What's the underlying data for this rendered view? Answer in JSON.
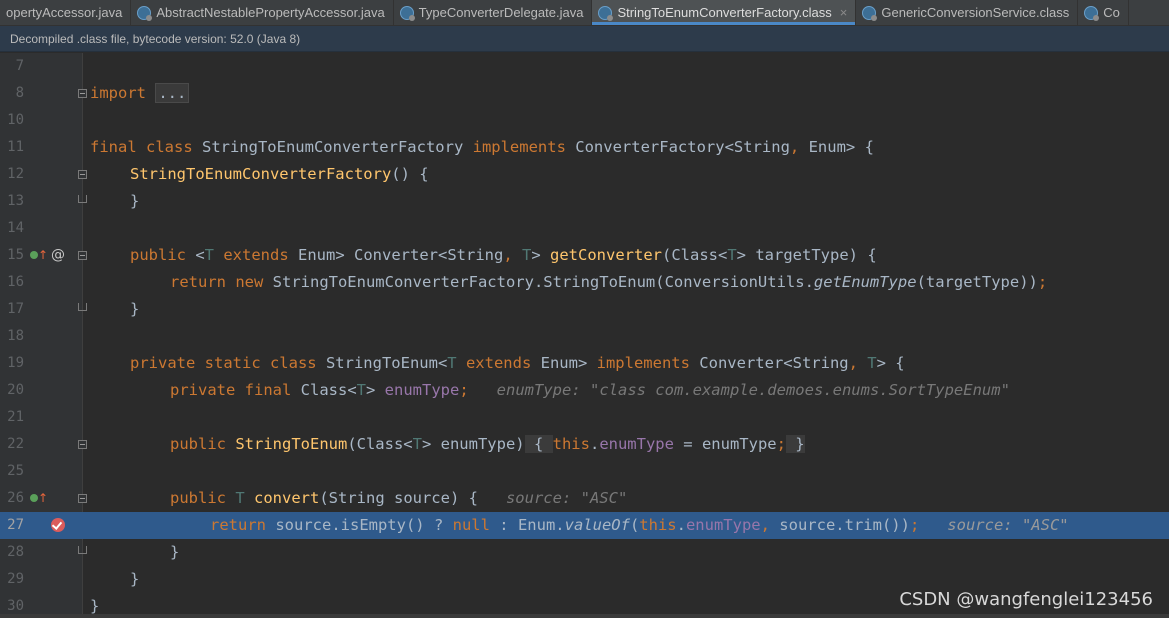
{
  "tabs": [
    {
      "label": "opertyAccessor.java",
      "icon": null
    },
    {
      "label": "AbstractNestablePropertyAccessor.java",
      "icon": "class-file-icon"
    },
    {
      "label": "TypeConverterDelegate.java",
      "icon": "class-file-icon"
    },
    {
      "label": "StringToEnumConverterFactory.class",
      "icon": "class-file-icon",
      "active": true
    },
    {
      "label": "GenericConversionService.class",
      "icon": "class-file-icon"
    },
    {
      "label": "Co",
      "icon": "class-file-icon"
    }
  ],
  "tab_close_glyph": "×",
  "notice": "Decompiled .class file, bytecode version: 52.0 (Java 8)",
  "line_numbers": [
    "7",
    "8",
    "10",
    "11",
    "12",
    "13",
    "14",
    "15",
    "16",
    "17",
    "18",
    "19",
    "20",
    "21",
    "22",
    "25",
    "26",
    "27",
    "28",
    "29",
    "30"
  ],
  "code": {
    "l8": {
      "kw": "import",
      "fold": "..."
    },
    "l11": {
      "kw1": "final class ",
      "name": "StringToEnumConverterFactory ",
      "kw2": "implements ",
      "rest": "ConverterFactory<String",
      "comma": ",",
      "rest2": " Enum> {"
    },
    "l12": {
      "fn": "StringToEnumConverterFactory",
      "rest": "() {"
    },
    "l13": {
      "text": "}"
    },
    "l15": {
      "kw": "public ",
      "lt": "<",
      "tp": "T",
      "kw2": " extends ",
      "mid": "Enum> Converter<String",
      "comma": ",",
      "tp2": " T",
      "gt": "> ",
      "fn": "getConverter",
      "rest": "(Class<",
      "tp3": "T",
      "rest2": "> targetType) {"
    },
    "l16": {
      "kw": "return new ",
      "a": "StringToEnumConverterFactory.StringToEnum(ConversionUtils.",
      "it": "getEnumType",
      "b": "(targetType))",
      "semi": ";"
    },
    "l17": {
      "text": "}"
    },
    "l19": {
      "kw": "private static class ",
      "name": "StringToEnum<",
      "tp": "T",
      "kw2": " extends ",
      "mid": "Enum> ",
      "kw3": "implements ",
      "rest": "Converter<String",
      "comma": ",",
      "tp2": " T",
      "rest2": "> {"
    },
    "l20": {
      "kw": "private final ",
      "a": "Class<",
      "tp": "T",
      "b": "> ",
      "fld": "enumType",
      "semi": ";",
      "hint": "enumType: \"class com.example.demoes.enums.SortTypeEnum\""
    },
    "l22": {
      "kw": "public ",
      "fn": "StringToEnum",
      "a": "(Class<",
      "tp": "T",
      "b": "> enumType)",
      "c": " { ",
      "kw2": "this",
      "d": ".",
      "fld": "enumType",
      "e": " = enumType",
      "semi": ";",
      "f": " }"
    },
    "l26": {
      "kw": "public ",
      "tp": "T ",
      "fn": "convert",
      "rest": "(String source) {",
      "hint": "source: \"ASC\""
    },
    "l27": {
      "kw": "return ",
      "a": "source.isEmpty() ? ",
      "kw2": "null",
      "b": " : Enum.",
      "it": "valueOf",
      "c": "(",
      "kw3": "this",
      "d": ".",
      "fld": "enumType",
      "comma": ",",
      "e": " source.trim())",
      "semi": ";",
      "hint": "source: \"ASC\""
    },
    "l28": {
      "text": "}"
    },
    "l29": {
      "text": "}"
    },
    "l30": {
      "text": "}"
    }
  },
  "watermark": "CSDN @wangfenglei123456",
  "colors": {
    "keyword": "#cc7832",
    "function": "#ffc66d",
    "type_param": "#507874",
    "field": "#9876aa",
    "current_line": "#2f5a8c",
    "active_tab_underline": "#4a88c7"
  }
}
